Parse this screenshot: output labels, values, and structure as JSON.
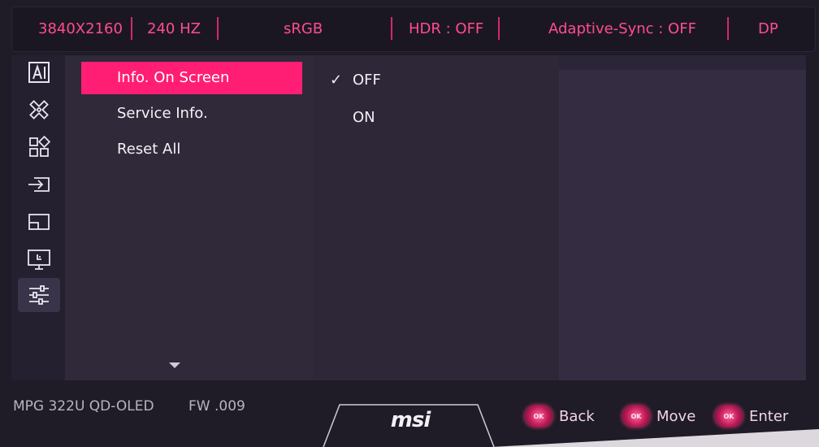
{
  "status": {
    "resolution": "3840X2160",
    "refresh": "240 HZ",
    "color_mode": "sRGB",
    "hdr": "HDR : OFF",
    "adaptive_sync": "Adaptive-Sync : OFF",
    "input": "DP"
  },
  "sidebar": {
    "icons": [
      "ai-icon",
      "gamepad-icon",
      "apps-grid-icon",
      "input-source-icon",
      "pip-icon",
      "monitor-settings-icon",
      "sliders-icon"
    ],
    "active_index": 6
  },
  "menu": {
    "items": [
      {
        "label": "Info. On Screen",
        "selected": true
      },
      {
        "label": "Service Info.",
        "selected": false
      },
      {
        "label": "Reset All",
        "selected": false
      }
    ]
  },
  "options": {
    "items": [
      {
        "label": "OFF",
        "checked": true
      },
      {
        "label": "ON",
        "checked": false
      }
    ],
    "check_glyph": "✓"
  },
  "footer": {
    "model": "MPG 322U QD-OLED",
    "firmware": "FW .009",
    "logo": "msi",
    "button_glyph": "OK",
    "back_label": "Back",
    "move_label": "Move",
    "enter_label": "Enter"
  },
  "colors": {
    "accent": "#ff1e73",
    "status_text": "#ff4d8e",
    "panel_bg": "#2b2537"
  }
}
